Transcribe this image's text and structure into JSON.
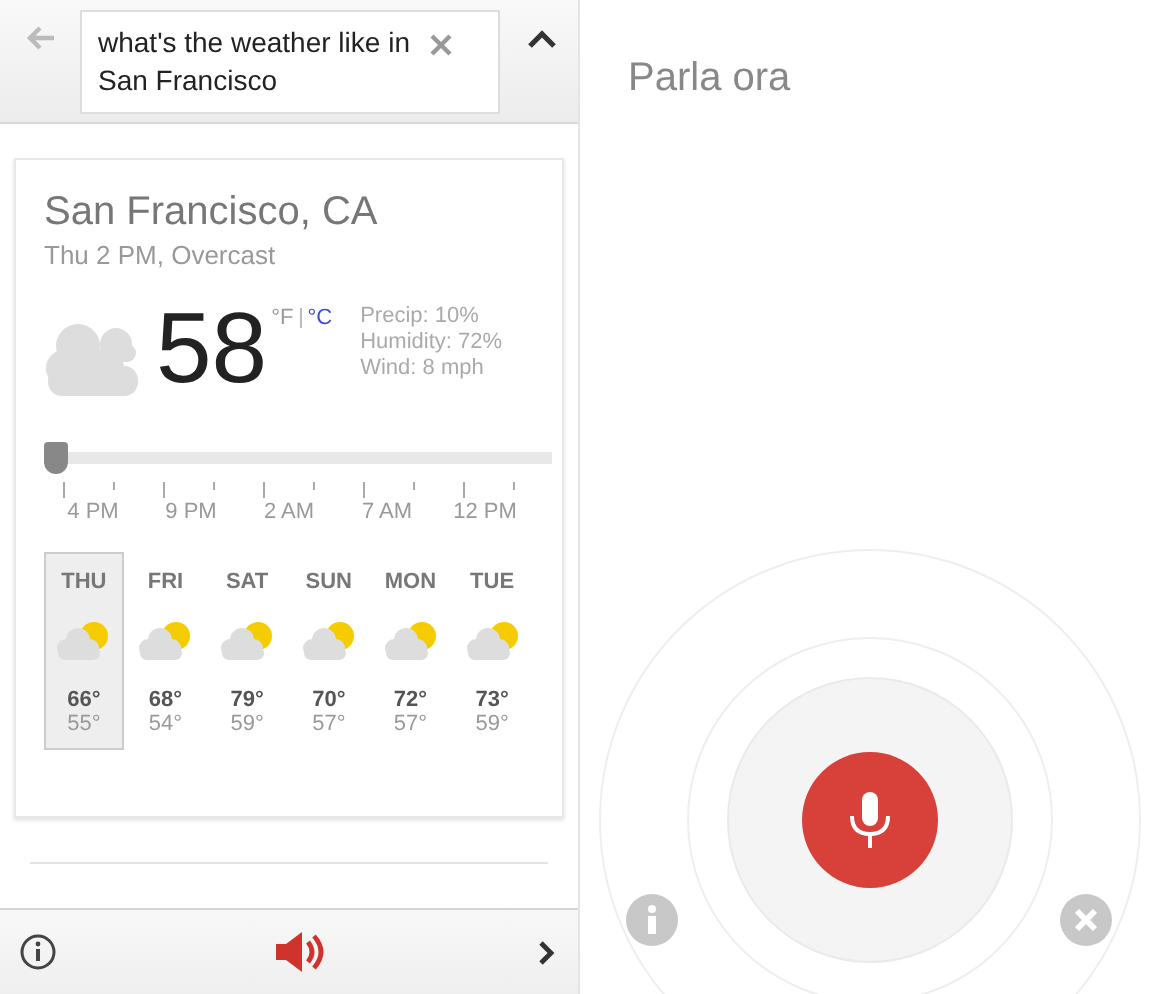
{
  "search": {
    "value": "what's the weather like in San Francisco"
  },
  "weather": {
    "location": "San Francisco, CA",
    "condition": "Thu 2 PM, Overcast",
    "temperature": "58",
    "units": [
      {
        "label": "°F",
        "selected": true
      },
      {
        "label": "°C",
        "selected": false
      }
    ],
    "details": [
      "Precip: 10%",
      "Humidity: 72%",
      "Wind: 8 mph"
    ],
    "timeline": {
      "level": 0,
      "labels": [
        "4 PM",
        "9 PM",
        "2 AM",
        "7 AM",
        "12 PM"
      ]
    },
    "days": [
      {
        "day": "THU",
        "high": "66°",
        "low": "55°",
        "selected": true
      },
      {
        "day": "FRI",
        "high": "68°",
        "low": "54°",
        "selected": false
      },
      {
        "day": "SAT",
        "high": "79°",
        "low": "59°",
        "selected": false
      },
      {
        "day": "SUN",
        "high": "70°",
        "low": "57°",
        "selected": false
      },
      {
        "day": "MON",
        "high": "72°",
        "low": "57°",
        "selected": false
      },
      {
        "day": "TUE",
        "high": "73°",
        "low": "59°",
        "selected": false
      }
    ]
  },
  "voice": {
    "prompt": "Parla ora"
  }
}
